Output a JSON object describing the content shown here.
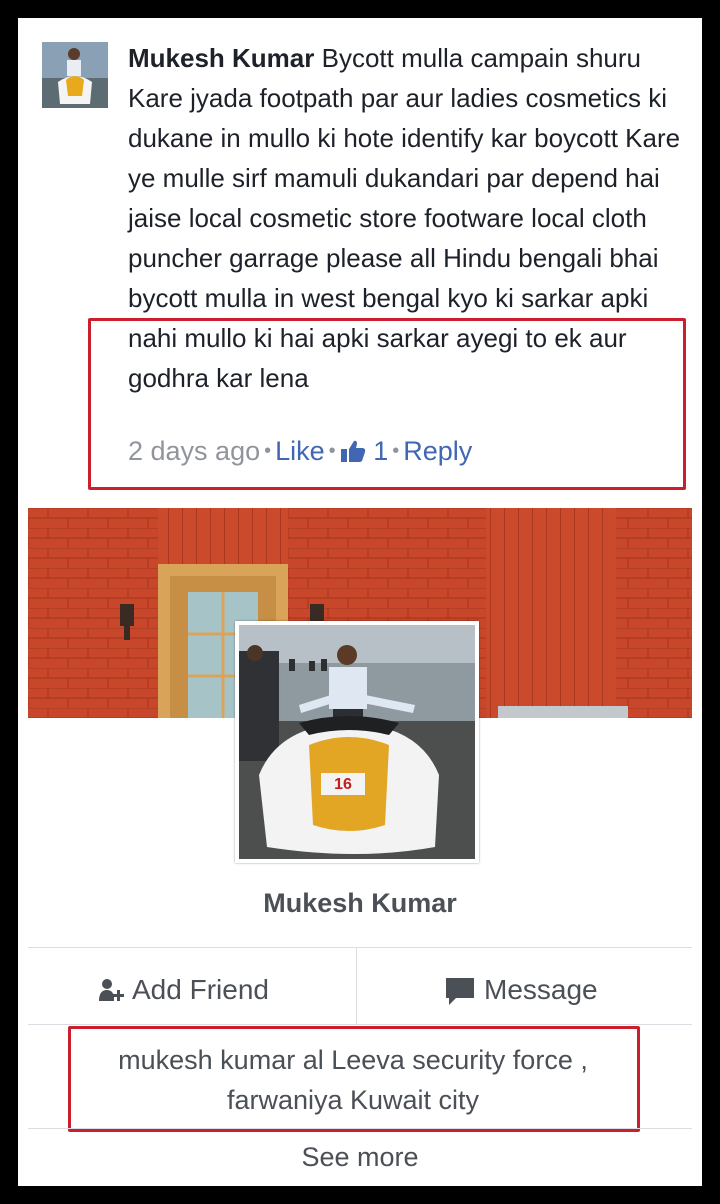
{
  "comment": {
    "author": "Mukesh Kumar",
    "text": "Bycott mulla campain shuru Kare jyada footpath par aur ladies cosmetics ki dukane in mullo ki hote identify kar boycott Kare ye mulle sirf mamuli dukandari par depend hai jaise local cosmetic store footware local cloth puncher garrage please all Hindu bengali bhai bycott mulla in west bengal kyo ki sarkar apki nahi mullo ki hai apki sarkar ayegi to ek aur godhra kar lena",
    "time": "2 days ago",
    "like_label": "Like",
    "like_count": "1",
    "reply_label": "Reply"
  },
  "profile": {
    "name": "Mukesh Kumar",
    "add_friend_label": "Add Friend",
    "message_label": "Message",
    "info": "mukesh  kumar al Leeva security force , farwaniya Kuwait city",
    "see_more_label": "See more"
  },
  "colors": {
    "highlight_box": "#cc1f2d",
    "link": "#4267b2",
    "muted_text": "#90949c",
    "brick_wall": "#c8462a"
  }
}
